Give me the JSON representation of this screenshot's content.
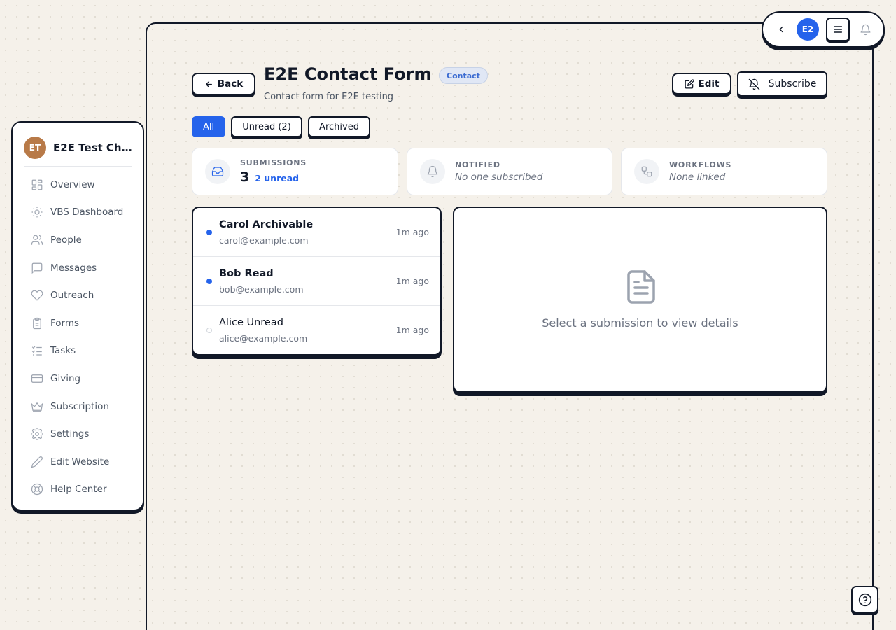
{
  "topbar": {
    "avatar_initials": "E2"
  },
  "sidebar": {
    "org_initials": "ET",
    "org_name": "E2E Test Ch…",
    "items": [
      {
        "label": "Overview",
        "icon": "grid-icon"
      },
      {
        "label": "VBS Dashboard",
        "icon": "sun-icon"
      },
      {
        "label": "People",
        "icon": "users-icon"
      },
      {
        "label": "Messages",
        "icon": "message-icon"
      },
      {
        "label": "Outreach",
        "icon": "heart-icon"
      },
      {
        "label": "Forms",
        "icon": "clipboard-icon"
      },
      {
        "label": "Tasks",
        "icon": "checklist-icon"
      },
      {
        "label": "Giving",
        "icon": "credit-card-icon"
      },
      {
        "label": "Subscription",
        "icon": "crown-icon"
      },
      {
        "label": "Settings",
        "icon": "gear-icon"
      },
      {
        "label": "Edit Website",
        "icon": "pencil-icon"
      },
      {
        "label": "Help Center",
        "icon": "lifebuoy-icon"
      }
    ]
  },
  "header": {
    "back_label": "Back",
    "title": "E2E Contact Form",
    "badge": "Contact",
    "description": "Contact form for E2E testing",
    "edit_label": "Edit",
    "subscribe_label": "Subscribe"
  },
  "tabs": {
    "all": "All",
    "unread": "Unread (2)",
    "archived": "Archived"
  },
  "stats": {
    "submissions_label": "SUBMISSIONS",
    "submissions_count": "3",
    "submissions_unread": "2 unread",
    "notified_label": "NOTIFIED",
    "notified_value": "No one subscribed",
    "workflows_label": "WORKFLOWS",
    "workflows_value": "None linked"
  },
  "submissions": [
    {
      "name": "Carol Archivable",
      "email": "carol@example.com",
      "time": "1m ago",
      "unread": true
    },
    {
      "name": "Bob Read",
      "email": "bob@example.com",
      "time": "1m ago",
      "unread": true
    },
    {
      "name": "Alice Unread",
      "email": "alice@example.com",
      "time": "1m ago",
      "unread": false
    }
  ],
  "detail": {
    "empty_text": "Select a submission to view details"
  },
  "colors": {
    "accent": "#2563eb",
    "border": "#111827",
    "background": "#f5f1ea"
  }
}
